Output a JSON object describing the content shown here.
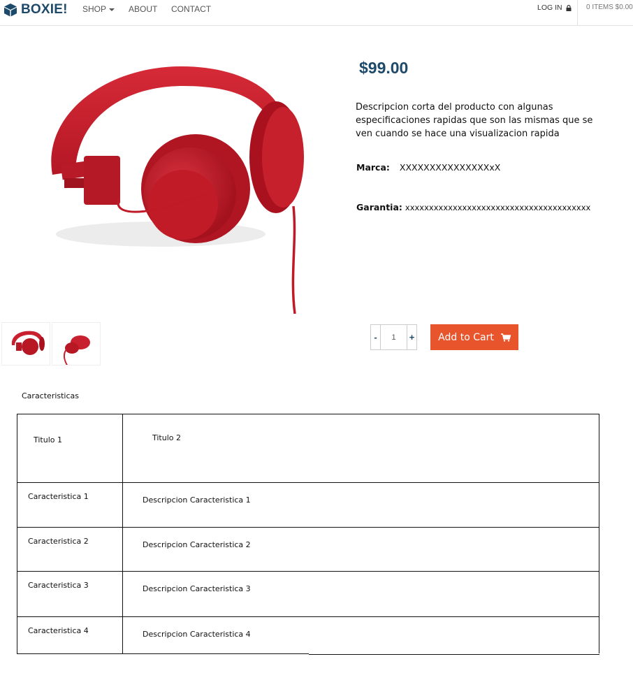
{
  "nav": {
    "brand": "BOXIE!",
    "links": [
      "SHOP",
      "ABOUT",
      "CONTACT"
    ],
    "login": "LOG IN",
    "cart_summary": "0 ITEMS $0.00"
  },
  "product": {
    "price": "$99.00",
    "short_description": "Descripcion corta del producto con algunas especificaciones rapidas que son las mismas que se ven cuando se hace una visualizacion rapida",
    "brand_label": "Marca:",
    "brand_value": "XXXXXXXXXXXXXXXxX",
    "warranty_label": "Garantia:",
    "warranty_value": "xxxxxxxxxxxxxxxxxxxxxxxxxxxxxxxxxxxxxxx",
    "product_color": "#c8202e"
  },
  "purchase": {
    "minus": "-",
    "plus": "+",
    "quantity": "1",
    "add_to_cart": "Add to Cart"
  },
  "features": {
    "heading": "Caracteristicas",
    "header": [
      "Titulo 1",
      "Titulo 2"
    ],
    "rows": [
      [
        "Caracteristica 1",
        "Descripcion Caracteristica 1"
      ],
      [
        "Caracteristica 2",
        "Descripcion Caracteristica  2"
      ],
      [
        "Caracteristica  3",
        "Descripcion Caracteristica  3"
      ],
      [
        "Caracteristica  4",
        "Descripcion Caracteristica  4"
      ]
    ]
  },
  "colors": {
    "brand": "#1d4a6b",
    "accent": "#e8542b"
  }
}
